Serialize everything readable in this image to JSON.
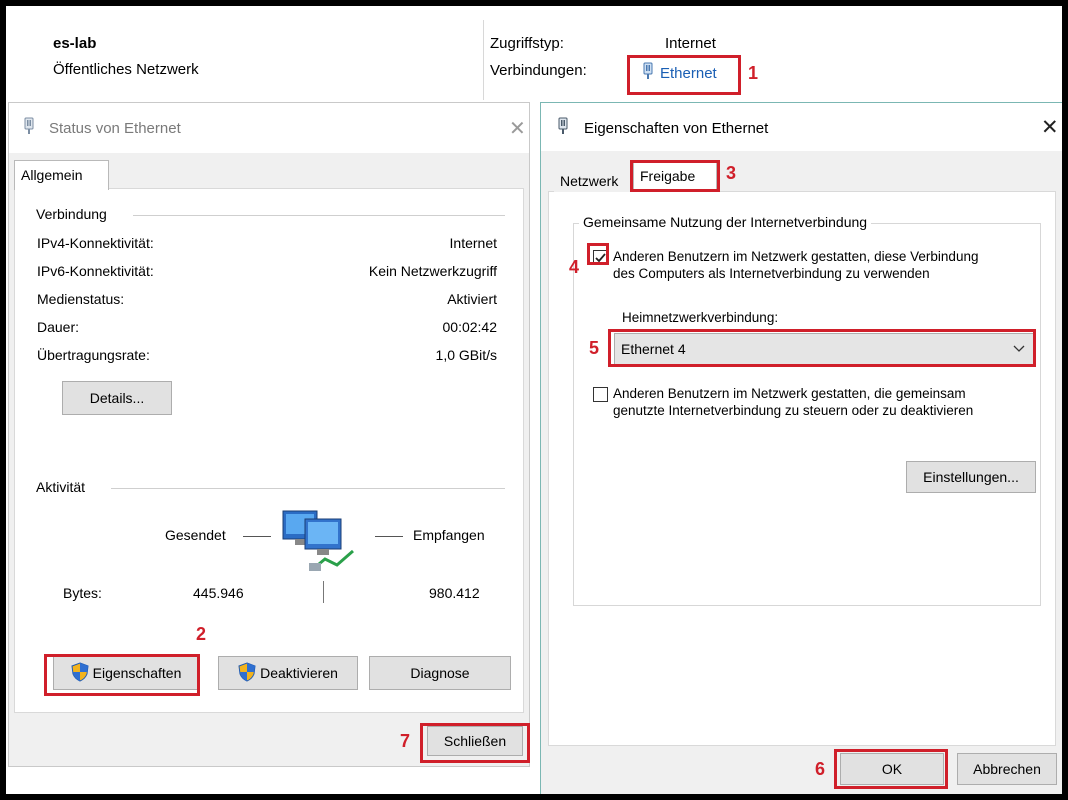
{
  "network": {
    "name": "es-lab",
    "type": "Öffentliches Netzwerk",
    "access_label": "Zugriffstyp:",
    "access_value": "Internet",
    "connections_label": "Verbindungen:",
    "connection_link": "Ethernet"
  },
  "annotations": [
    "1",
    "2",
    "3",
    "4",
    "5",
    "6",
    "7"
  ],
  "accent_colors": {
    "annotation_red": "#d01f2a",
    "link_blue": "#1a5fb4"
  },
  "status_dialog": {
    "title": "Status von Ethernet",
    "tab": "Allgemein",
    "connection_group": "Verbindung",
    "rows": [
      {
        "label": "IPv4-Konnektivität:",
        "value": "Internet"
      },
      {
        "label": "IPv6-Konnektivität:",
        "value": "Kein Netzwerkzugriff"
      },
      {
        "label": "Medienstatus:",
        "value": "Aktiviert"
      },
      {
        "label": "Dauer:",
        "value": "00:02:42"
      },
      {
        "label": "Übertragungsrate:",
        "value": "1,0 GBit/s"
      }
    ],
    "details_button": "Details...",
    "activity_group": "Aktivität",
    "sent_label": "Gesendet",
    "received_label": "Empfangen",
    "bytes_label": "Bytes:",
    "bytes_sent": "445.946",
    "bytes_received": "980.412",
    "properties_button": "Eigenschaften",
    "disable_button": "Deaktivieren",
    "diagnose_button": "Diagnose",
    "close_button": "Schließen"
  },
  "props_dialog": {
    "title": "Eigenschaften von Ethernet",
    "tab_network": "Netzwerk",
    "tab_sharing": "Freigabe",
    "group_title": "Gemeinsame Nutzung der Internetverbindung",
    "allow_sharing_line1": "Anderen Benutzern im Netzwerk gestatten, diese Verbindung",
    "allow_sharing_line2": "des Computers als Internetverbindung zu verwenden",
    "allow_sharing_checked": true,
    "home_network_label": "Heimnetzwerkverbindung:",
    "home_network_value": "Ethernet 4",
    "allow_control_line1": "Anderen Benutzern im Netzwerk gestatten, die gemeinsam",
    "allow_control_line2": "genutzte Internetverbindung zu steuern oder zu deaktivieren",
    "allow_control_checked": false,
    "settings_button": "Einstellungen...",
    "ok_button": "OK",
    "cancel_button": "Abbrechen"
  }
}
